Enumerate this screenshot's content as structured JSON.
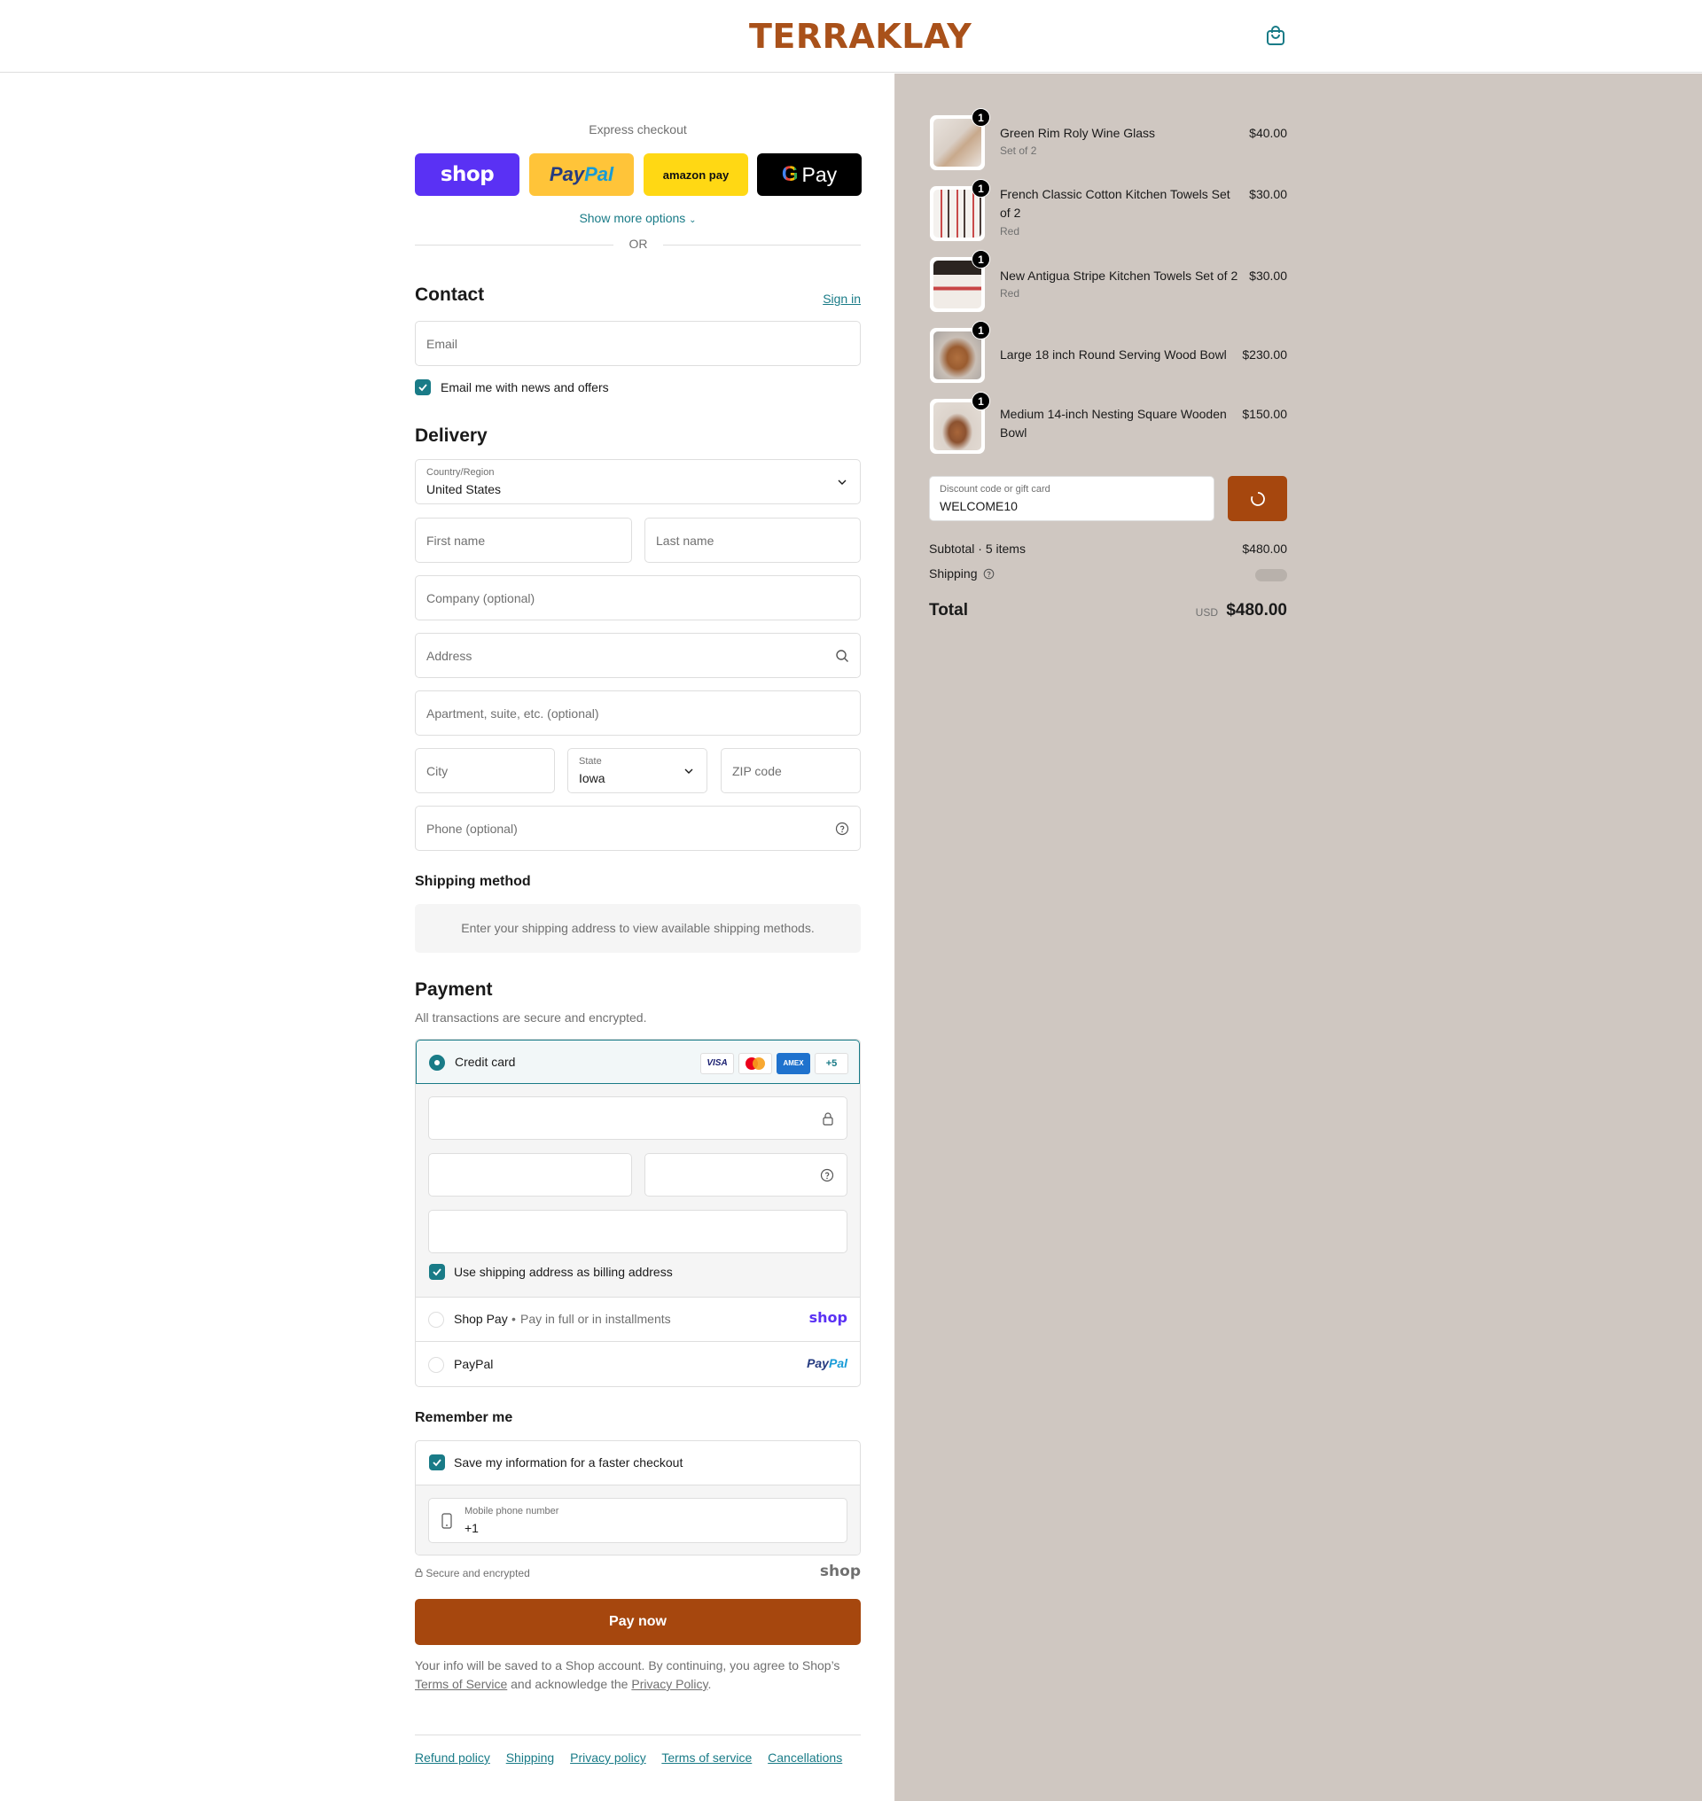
{
  "header": {
    "logo": "TERRAKLAY",
    "cart_icon": "shopping-bag-icon"
  },
  "express": {
    "title": "Express checkout",
    "buttons": {
      "shop": "shop",
      "paypal_a": "Pay",
      "paypal_b": "Pal",
      "amazon": "amazon pay",
      "gpay": "Pay"
    },
    "show_more": "Show more options",
    "or": "OR"
  },
  "contact": {
    "title": "Contact",
    "sign_in": "Sign in",
    "email_placeholder": "Email",
    "newsletter_label": "Email me with news and offers",
    "newsletter_checked": true
  },
  "delivery": {
    "title": "Delivery",
    "country_label": "Country/Region",
    "country_value": "United States",
    "first_name": "First name",
    "last_name": "Last name",
    "company": "Company (optional)",
    "address": "Address",
    "apartment": "Apartment, suite, etc. (optional)",
    "city": "City",
    "state_label": "State",
    "state_value": "Iowa",
    "zip": "ZIP code",
    "phone": "Phone (optional)"
  },
  "shipping_method": {
    "title": "Shipping method",
    "info": "Enter your shipping address to view available shipping methods."
  },
  "payment": {
    "title": "Payment",
    "subtitle": "All transactions are secure and encrypted.",
    "credit_card_label": "Credit card",
    "cards": {
      "visa": "VISA",
      "amex": "AMEX",
      "more": "+5"
    },
    "billing_label": "Use shipping address as billing address",
    "billing_checked": true,
    "shop_pay_label": "Shop Pay",
    "shop_pay_sub": "Pay in full or in installments",
    "shop_pay_logo": "shop",
    "paypal_label": "PayPal",
    "paypal_logo_a": "Pay",
    "paypal_logo_b": "Pal"
  },
  "remember": {
    "title": "Remember me",
    "save_label": "Save my information for a faster checkout",
    "save_checked": true,
    "mobile_label": "Mobile phone number",
    "mobile_value": "+1",
    "secure_label": "Secure and encrypted",
    "shop_logo": "shop"
  },
  "pay_now": "Pay now",
  "legal": {
    "line1": "Your info will be saved to a Shop account. By continuing, you agree to Shop’s",
    "terms": "Terms of Service",
    "mid": "and acknowledge the",
    "privacy": "Privacy Policy",
    "end": "."
  },
  "footer": [
    "Refund policy",
    "Shipping",
    "Privacy policy",
    "Terms of service",
    "Cancellations"
  ],
  "order": {
    "items": [
      {
        "qty": "1",
        "name": "Green Rim Roly Wine Glass",
        "variant": "Set of 2",
        "price": "$40.00"
      },
      {
        "qty": "1",
        "name_l1": "French Classic Cotton Kitchen Towels Set",
        "name_l2": "of 2",
        "variant": "Red",
        "price": "$30.00"
      },
      {
        "qty": "1",
        "name": "New Antigua Stripe Kitchen Towels Set of 2",
        "variant": "Red",
        "price": "$30.00"
      },
      {
        "qty": "1",
        "name": "Large 18 inch Round Serving Wood Bowl",
        "price": "$230.00"
      },
      {
        "qty": "1",
        "name_l1": "Medium 14-inch Nesting Square Wooden",
        "name_l2": "Bowl",
        "price": "$150.00"
      }
    ],
    "discount_label": "Discount code or gift card",
    "discount_value": "WELCOME10",
    "subtotal_label": "Subtotal · 5 items",
    "subtotal_value": "$480.00",
    "shipping_label": "Shipping",
    "total_label": "Total",
    "currency": "USD",
    "total_value": "$480.00"
  },
  "colors": {
    "accent": "#197b87",
    "brand": "#a9511a",
    "button": "#a6470e",
    "sidebar": "#cfc7c1"
  }
}
